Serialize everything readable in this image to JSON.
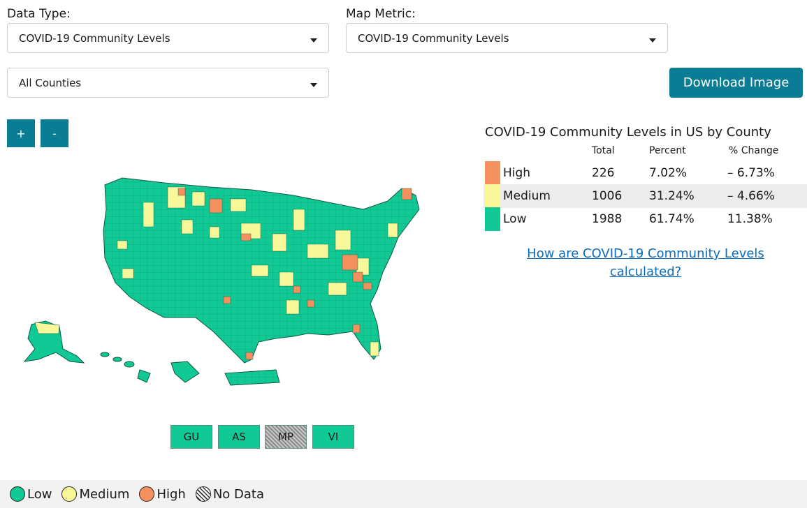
{
  "filters": {
    "data_type_label": "Data Type:",
    "data_type_value": "COVID-19 Community Levels",
    "map_metric_label": "Map Metric:",
    "map_metric_value": "COVID-19 Community Levels",
    "geography_value": "All Counties"
  },
  "toolbar": {
    "download_label": "Download Image",
    "zoom_in_label": "+",
    "zoom_out_label": "-"
  },
  "territories": [
    "GU",
    "AS",
    "MP",
    "VI"
  ],
  "stats": {
    "title": "COVID-19 Community Levels in US by County",
    "headers": {
      "total": "Total",
      "percent": "Percent",
      "change": "% Change"
    },
    "rows": [
      {
        "level": "High",
        "total": "226",
        "percent": "7.02%",
        "change": "– 6.73%",
        "color": "#f4915e"
      },
      {
        "level": "Medium",
        "total": "1006",
        "percent": "31.24%",
        "change": "– 4.66%",
        "color": "#f8f89a"
      },
      {
        "level": "Low",
        "total": "1988",
        "percent": "61.74%",
        "change": "11.38%",
        "color": "#10c995"
      }
    ],
    "help_link": "How are COVID-19 Community Levels calculated?"
  },
  "legend": {
    "low": "Low",
    "medium": "Medium",
    "high": "High",
    "nodata": "No Data"
  },
  "colors": {
    "low": "#10c995",
    "medium": "#f8f89a",
    "high": "#f4915e",
    "accent": "#0a7d95"
  }
}
